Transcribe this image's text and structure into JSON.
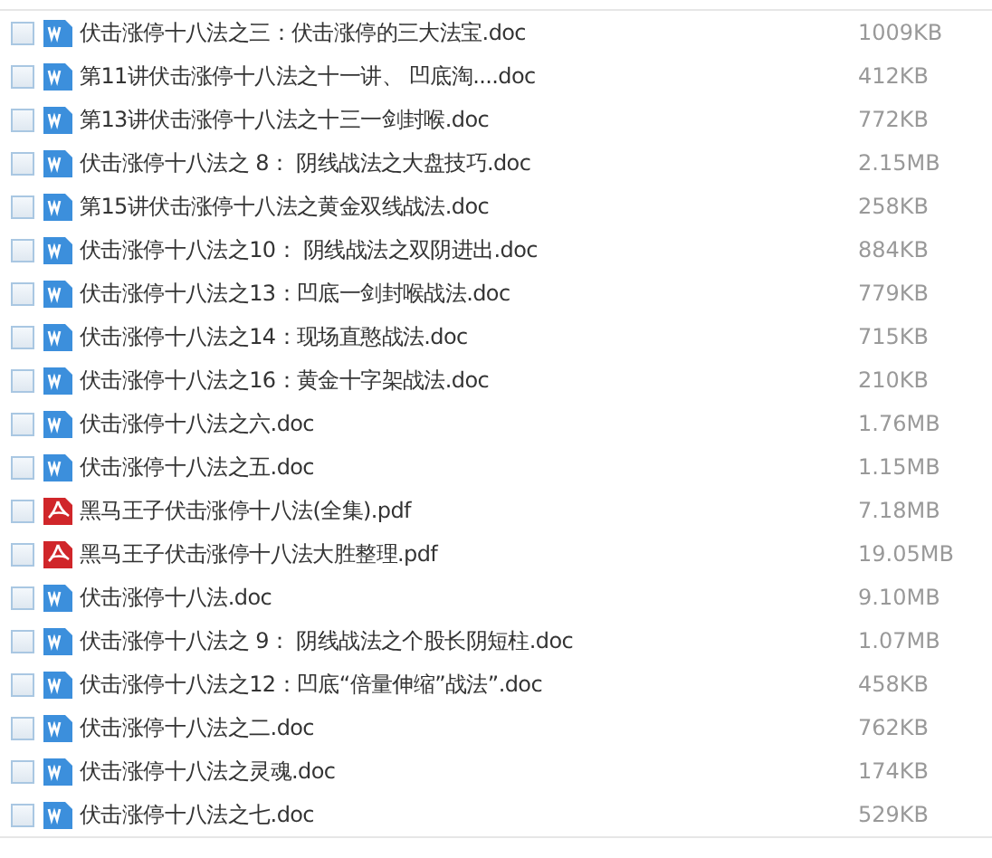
{
  "files": [
    {
      "name": "伏击涨停十八法之三：伏击涨停的三大法宝.doc",
      "size": "1009KB",
      "kind": "doc",
      "checked": false
    },
    {
      "name": "第11讲伏击涨停十八法之十一讲、 凹底淘....doc",
      "size": "412KB",
      "kind": "doc",
      "checked": false
    },
    {
      "name": "第13讲伏击涨停十八法之十三一剑封喉.doc",
      "size": "772KB",
      "kind": "doc",
      "checked": false
    },
    {
      "name": "伏击涨停十八法之 8： 阴线战法之大盘技巧.doc",
      "size": "2.15MB",
      "kind": "doc",
      "checked": false
    },
    {
      "name": "第15讲伏击涨停十八法之黄金双线战法.doc",
      "size": "258KB",
      "kind": "doc",
      "checked": false
    },
    {
      "name": "伏击涨停十八法之10： 阴线战法之双阴进出.doc",
      "size": "884KB",
      "kind": "doc",
      "checked": false
    },
    {
      "name": "伏击涨停十八法之13：凹底一剑封喉战法.doc",
      "size": "779KB",
      "kind": "doc",
      "checked": false
    },
    {
      "name": "伏击涨停十八法之14：现场直憨战法.doc",
      "size": "715KB",
      "kind": "doc",
      "checked": false
    },
    {
      "name": "伏击涨停十八法之16：黄金十字架战法.doc",
      "size": "210KB",
      "kind": "doc",
      "checked": false
    },
    {
      "name": "伏击涨停十八法之六.doc",
      "size": "1.76MB",
      "kind": "doc",
      "checked": false
    },
    {
      "name": "伏击涨停十八法之五.doc",
      "size": "1.15MB",
      "kind": "doc",
      "checked": false
    },
    {
      "name": "黑马王子伏击涨停十八法(全集).pdf",
      "size": "7.18MB",
      "kind": "pdf",
      "checked": false
    },
    {
      "name": "黑马王子伏击涨停十八法大胜整理.pdf",
      "size": "19.05MB",
      "kind": "pdf",
      "checked": false
    },
    {
      "name": "伏击涨停十八法.doc",
      "size": "9.10MB",
      "kind": "doc",
      "checked": false
    },
    {
      "name": "伏击涨停十八法之 9： 阴线战法之个股长阴短柱.doc",
      "size": "1.07MB",
      "kind": "doc",
      "checked": false
    },
    {
      "name": "伏击涨停十八法之12：凹底“倍量伸缩”战法”.doc",
      "size": "458KB",
      "kind": "doc",
      "checked": false
    },
    {
      "name": "伏击涨停十八法之二.doc",
      "size": "762KB",
      "kind": "doc",
      "checked": false
    },
    {
      "name": "伏击涨停十八法之灵魂.doc",
      "size": "174KB",
      "kind": "doc",
      "checked": false
    },
    {
      "name": "伏击涨停十八法之七.doc",
      "size": "529KB",
      "kind": "doc",
      "checked": false
    }
  ]
}
